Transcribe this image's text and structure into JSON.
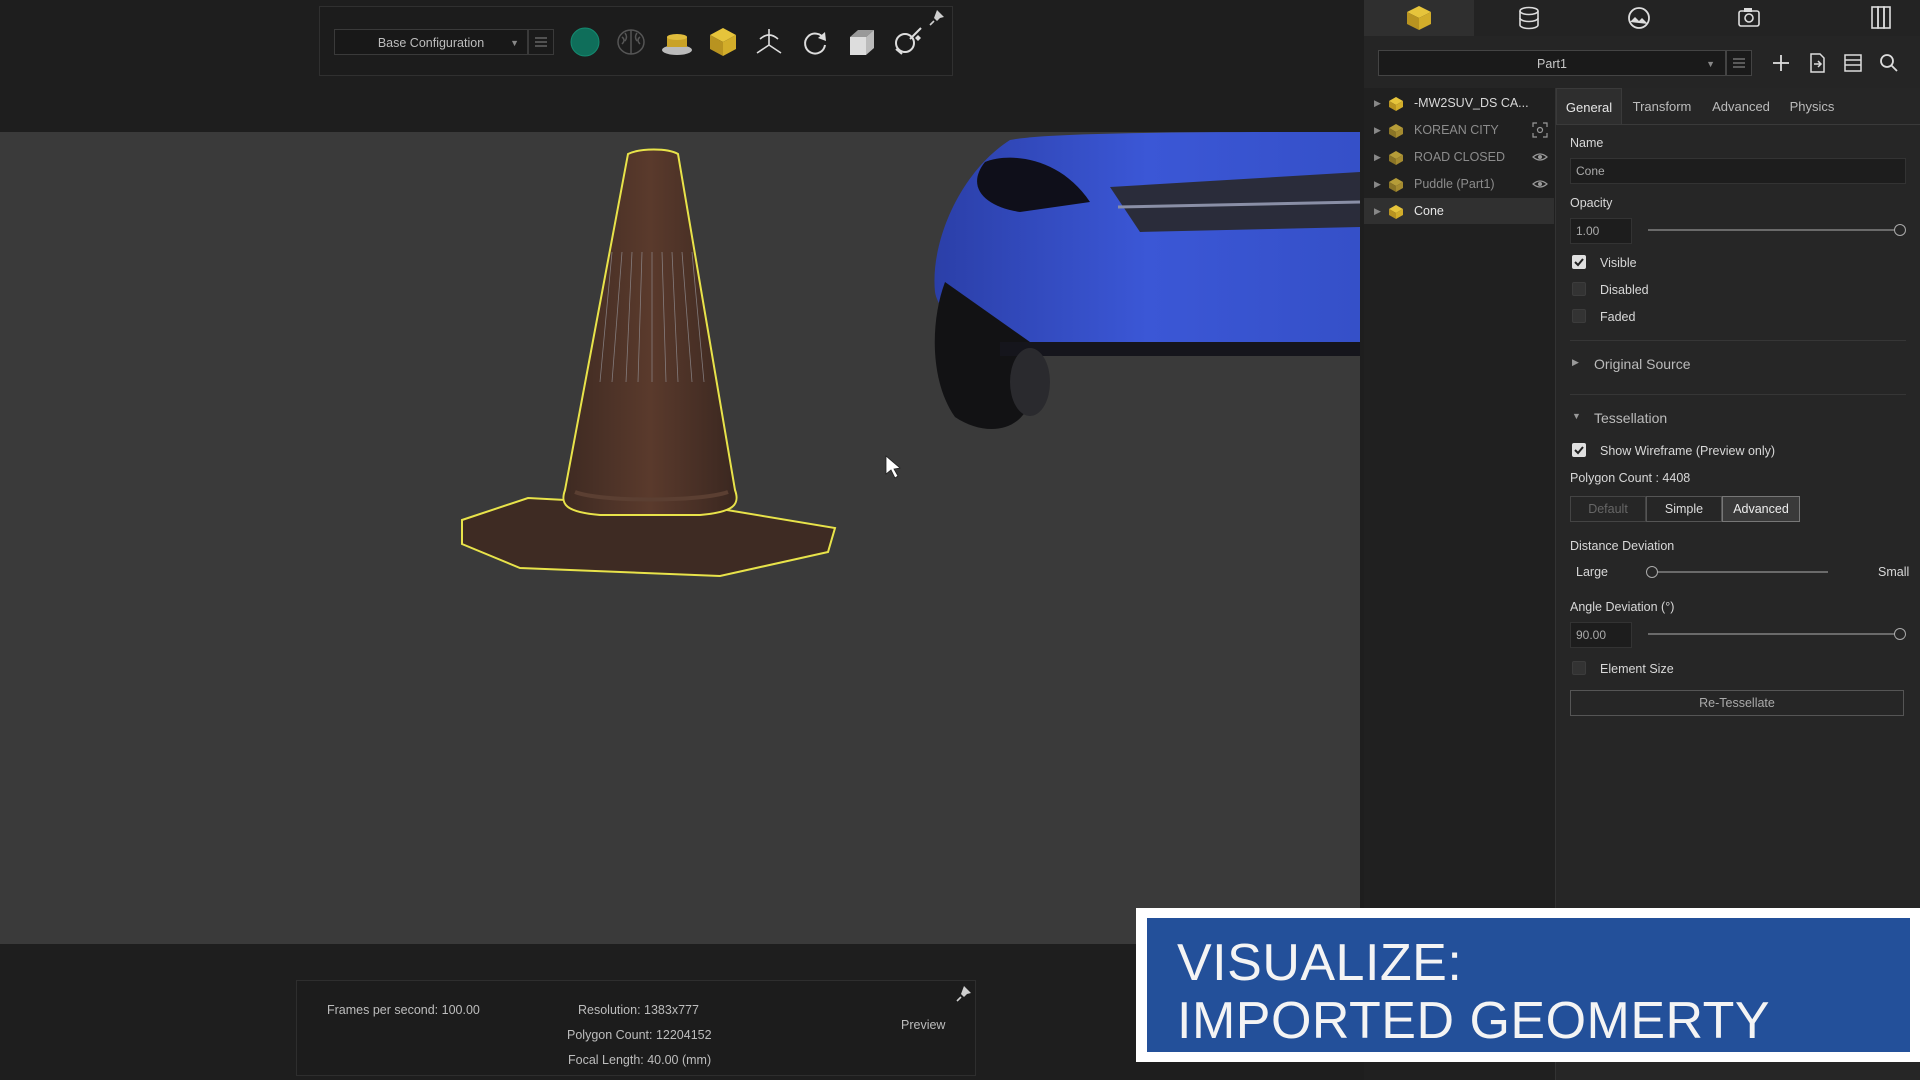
{
  "toolbar": {
    "configuration": "Base Configuration",
    "icons": [
      "config-menu-icon",
      "sphere-icon",
      "brain-icon",
      "turntable-icon",
      "cube-icon",
      "axes-icon",
      "refresh-icon",
      "box-icon",
      "magic-wand-icon",
      "pin-icon"
    ]
  },
  "status": {
    "fps": "Frames per second: 100.00",
    "resolution": "Resolution: 1383x777",
    "polygons": "Polygon Count: 12204152",
    "focal": "Focal Length: 40.00 (mm)",
    "preview": "Preview"
  },
  "panel_tabs_icons": [
    "models-icon",
    "database-icon",
    "environment-icon",
    "camera-icon",
    "library-icon"
  ],
  "part_selector": {
    "value": "Part1"
  },
  "tree": {
    "items": [
      {
        "label": "-MW2SUV_DS CA..."
      },
      {
        "label": "KOREAN CITY"
      },
      {
        "label": "ROAD CLOSED"
      },
      {
        "label": "Puddle (Part1)"
      },
      {
        "label": "Cone"
      }
    ]
  },
  "props": {
    "tabs": [
      "General",
      "Transform",
      "Advanced",
      "Physics"
    ],
    "name_label": "Name",
    "name_value": "Cone",
    "opacity_label": "Opacity",
    "opacity_value": "1.00",
    "opacity_level": 1.0,
    "visible": "Visible",
    "disabled": "Disabled",
    "faded": "Faded",
    "original_source": "Original Source",
    "tessellation": "Tessellation",
    "show_wireframe": "Show Wireframe (Preview only)",
    "polygon_count": "Polygon Count :  4408",
    "modes": [
      "Default",
      "Simple",
      "Advanced"
    ],
    "distance_deviation": "Distance Deviation",
    "large": "Large",
    "small": "Small",
    "distance_level": 0.0,
    "angle_deviation": "Angle Deviation (°)",
    "angle_value": "90.00",
    "angle_level": 1.0,
    "element_size": "Element Size",
    "retessellate": "Re-Tessellate"
  },
  "overlay": {
    "line1": "VISUALIZE:",
    "line2": "IMPORTED GEOMERTY"
  },
  "colors": {
    "accent_gold": "#c9a227",
    "selection_yellow": "#e8e34a",
    "car_blue": "#3b57d6",
    "overlay_blue": "#23509a"
  }
}
